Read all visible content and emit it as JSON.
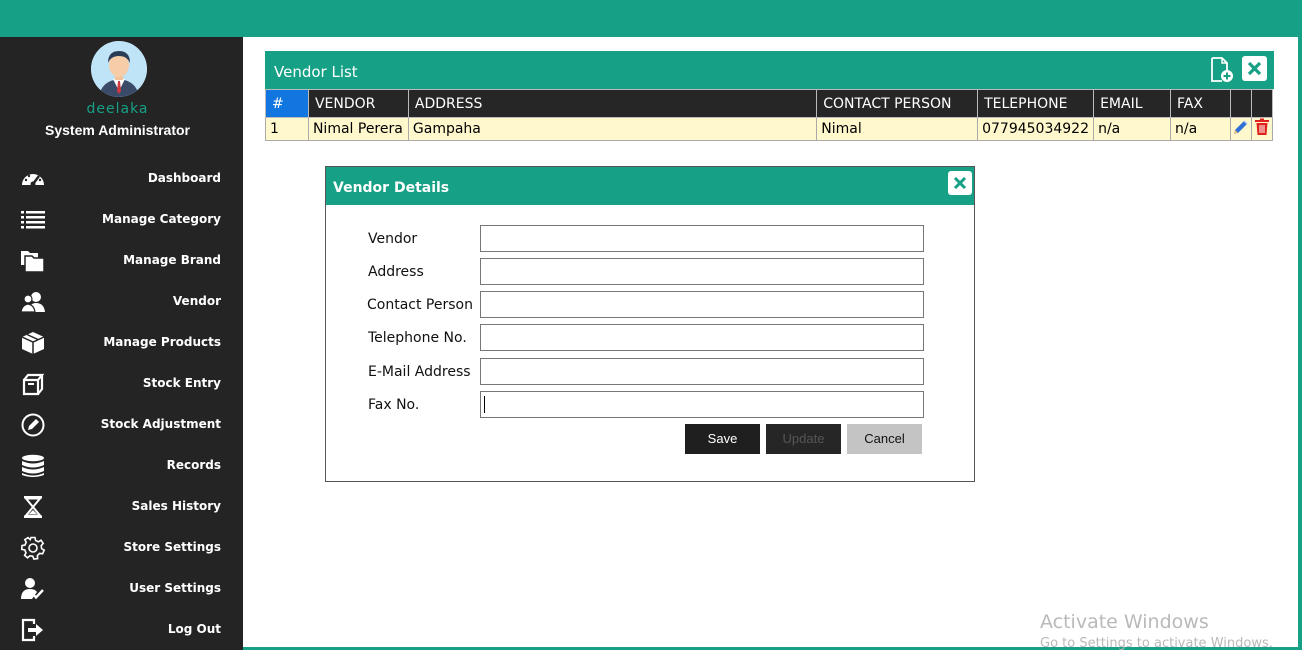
{
  "user": {
    "name": "deelaka",
    "role": "System Administrator"
  },
  "sidebar": {
    "items": [
      {
        "label": "Dashboard",
        "icon": "dashboard-icon"
      },
      {
        "label": "Manage Category",
        "icon": "list-icon"
      },
      {
        "label": "Manage Brand",
        "icon": "folders-icon"
      },
      {
        "label": "Vendor",
        "icon": "users-icon"
      },
      {
        "label": "Manage Products",
        "icon": "box-icon"
      },
      {
        "label": "Stock Entry",
        "icon": "boxes-icon"
      },
      {
        "label": "Stock Adjustment",
        "icon": "pencil-circle-icon"
      },
      {
        "label": "Records",
        "icon": "database-icon"
      },
      {
        "label": "Sales History",
        "icon": "hourglass-icon"
      },
      {
        "label": "Store Settings",
        "icon": "gear-icon"
      },
      {
        "label": "User Settings",
        "icon": "user-check-icon"
      },
      {
        "label": "Log Out",
        "icon": "logout-icon"
      }
    ]
  },
  "vendor_list": {
    "title": "Vendor List",
    "columns": [
      "#",
      "VENDOR",
      "ADDRESS",
      "CONTACT PERSON",
      "TELEPHONE",
      "EMAIL",
      "FAX"
    ],
    "rows": [
      {
        "num": "1",
        "vendor": "Nimal Perera",
        "address": "Gampaha",
        "contact": "Nimal",
        "telephone": "077945034922",
        "email": "n/a",
        "fax": "n/a"
      }
    ]
  },
  "vendor_details": {
    "title": "Vendor Details",
    "fields": [
      {
        "label": "Vendor",
        "value": ""
      },
      {
        "label": "Address",
        "value": ""
      },
      {
        "label": "Contact Person",
        "value": ""
      },
      {
        "label": "Telephone No.",
        "value": ""
      },
      {
        "label": "E-Mail Address",
        "value": ""
      },
      {
        "label": "Fax No.",
        "value": ""
      }
    ],
    "buttons": {
      "save": "Save",
      "update": "Update",
      "cancel": "Cancel"
    }
  },
  "watermark": {
    "line1": "Activate Windows",
    "line2": "Go to Settings to activate Windows."
  },
  "colors": {
    "accent": "#16a085",
    "sidebar": "#242424",
    "row_highlight": "#fff8cc",
    "header_num": "#1176e0"
  }
}
